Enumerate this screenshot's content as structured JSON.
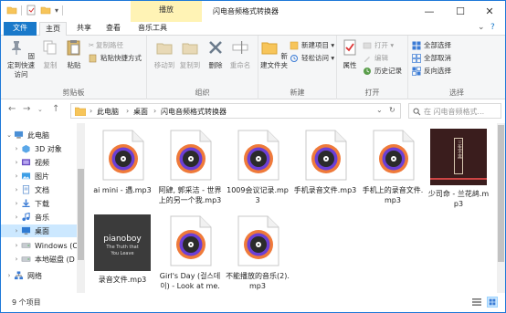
{
  "window": {
    "title": "闪电音频格式转换器",
    "context_tab": "播放",
    "controls": [
      "—",
      "☐",
      "✕"
    ]
  },
  "tabs": [
    "文件",
    "主页",
    "共享",
    "查看",
    "音乐工具"
  ],
  "ribbon": {
    "clipboard": {
      "pin": "固定到快速访问",
      "copy": "复制",
      "paste": "粘贴",
      "copy_path": "复制路径",
      "paste_shortcut": "粘贴快捷方式",
      "cut": "✂",
      "label": "剪贴板"
    },
    "organize": {
      "move_to": "移动到",
      "copy_to": "复制到",
      "delete": "删除",
      "rename": "重命名",
      "label": "组织"
    },
    "new": {
      "new_folder": "新建文件夹",
      "new_item": "新建项目 ▾",
      "easy_access": "轻松访问 ▾",
      "label": "新建"
    },
    "open": {
      "properties": "属性",
      "open": "打开 ▾",
      "edit": "编辑",
      "history": "历史记录",
      "label": "打开"
    },
    "select": {
      "select_all": "全部选择",
      "select_none": "全部取消",
      "invert": "反向选择",
      "label": "选择"
    }
  },
  "address": {
    "crumbs": [
      "此电脑",
      "桌面",
      "闪电音频格式转换器"
    ],
    "search_placeholder": "在 闪电音频格式..."
  },
  "nav_pane": [
    {
      "label": "此电脑",
      "icon": "computer-icon",
      "indent": 0,
      "expanded": true,
      "selected": false
    },
    {
      "label": "3D 对象",
      "icon": "3d-objects-icon",
      "indent": 1,
      "expanded": false,
      "selected": false
    },
    {
      "label": "视频",
      "icon": "videos-icon",
      "indent": 1,
      "expanded": false,
      "selected": false
    },
    {
      "label": "图片",
      "icon": "pictures-icon",
      "indent": 1,
      "expanded": false,
      "selected": false
    },
    {
      "label": "文档",
      "icon": "documents-icon",
      "indent": 1,
      "expanded": false,
      "selected": false
    },
    {
      "label": "下载",
      "icon": "downloads-icon",
      "indent": 1,
      "expanded": false,
      "selected": false
    },
    {
      "label": "音乐",
      "icon": "music-icon",
      "indent": 1,
      "expanded": false,
      "selected": false
    },
    {
      "label": "桌面",
      "icon": "desktop-icon",
      "indent": 1,
      "expanded": false,
      "selected": true
    },
    {
      "label": "Windows (C",
      "icon": "drive-icon",
      "indent": 1,
      "expanded": false,
      "selected": false
    },
    {
      "label": "本地磁盘 (D",
      "icon": "drive-icon",
      "indent": 1,
      "expanded": false,
      "selected": false
    },
    {
      "label": "网络",
      "icon": "network-icon",
      "indent": 0,
      "expanded": false,
      "selected": false
    }
  ],
  "files": [
    {
      "name": "ai mini - 遇.mp3",
      "kind": "disc"
    },
    {
      "name": "阿肆, 郭采洁 - 世界上的另一个我.mp3",
      "kind": "disc"
    },
    {
      "name": "1009会议记录.mp3",
      "kind": "disc"
    },
    {
      "name": "手机录音文件.mp3",
      "kind": "disc"
    },
    {
      "name": "手机上的录音文件.mp3",
      "kind": "disc"
    },
    {
      "name": "少司命 - 兰花鸪.mp3",
      "kind": "cover-red"
    },
    {
      "name": "录音文件.mp3",
      "kind": "cover-dark"
    },
    {
      "name": "Girl's Day (걸스데이) - Look at me.mp3",
      "kind": "disc"
    },
    {
      "name": "不能播放的音乐(2).mp3",
      "kind": "disc"
    }
  ],
  "covers": {
    "dark_line1": "pianoboy",
    "dark_line2": "The Truth that",
    "dark_line3": "You Leave",
    "red_text": "三生不离"
  },
  "status": {
    "count": "9 个项目"
  },
  "colors": {
    "accent": "#1979ca",
    "selected": "#cce8ff",
    "disc_orange": "#ef7a3a",
    "disc_purple": "#6b3fd6"
  }
}
